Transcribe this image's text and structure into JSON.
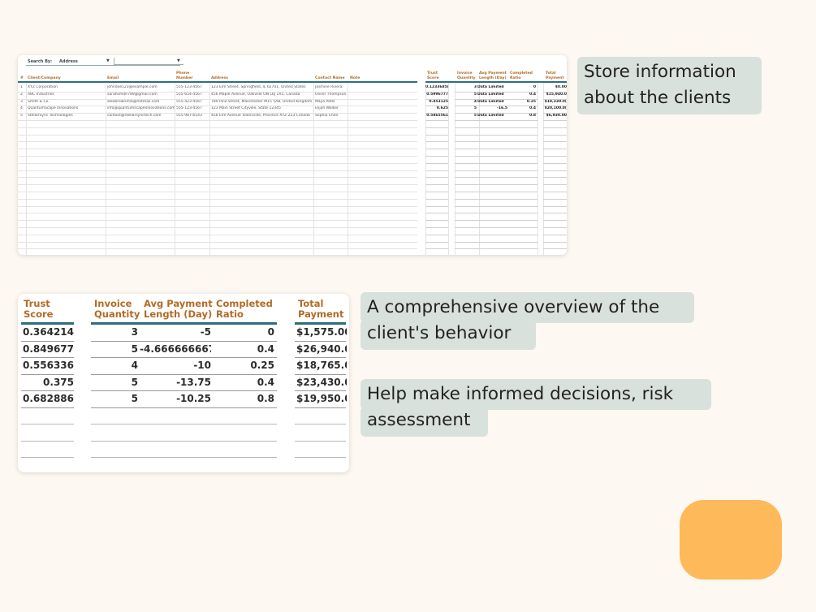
{
  "sheet": {
    "search_label": "Search By:",
    "search_value": "Address",
    "headers": {
      "num": "#",
      "client": "Client/Company",
      "email": "Email",
      "phone": "Phone Number",
      "address": "Address",
      "contact": "Contact Name",
      "note": "Note",
      "trust": "Trust Score",
      "invoice": "Invoice Quantity",
      "avg": "Avg Payment Length (Day)",
      "ratio": "Completed Ratio",
      "total": "Total Payment"
    },
    "rows": [
      {
        "num": "1",
        "client": "XYZ Corporation",
        "email": "johndoe123@example.com",
        "phone": "555-123-4567",
        "address": "123 Elm Street, Springfield, IL 62701, United States",
        "contact": "Jasmine Rivera",
        "trust": "0.1233685(",
        "invoice": "3",
        "avg": "Data Limited",
        "ratio": "0",
        "total": "$0.00"
      },
      {
        "num": "2",
        "client": "ABC Industries",
        "email": "sarahsmith789@gmail.com",
        "phone": "555-654-4567",
        "address": "456 Maple Avenue, Oakville ON L6J 1X5, Canada",
        "contact": "Oliver Thompson",
        "trust": "0.5996777",
        "invoice": "5",
        "avg": "Data Limited",
        "ratio": "0.4",
        "total": "$15,940.0"
      },
      {
        "num": "3",
        "client": "Smith & Co.",
        "email": "alexbrown456@hotmail.com",
        "phone": "555-423-4567",
        "address": "789 Pine Street, Manchester M15 5AB, United Kingdom",
        "contact": "Maya Patel",
        "trust": "0.453125",
        "invoice": "4",
        "avg": "Data Limited",
        "ratio": "0.25",
        "total": "$18,330.0("
      },
      {
        "num": "4",
        "client": "QuantumScape Innovations",
        "email": "info@quantumscapeinnovations.com",
        "phone": "555-123-4567",
        "address": "123 Main Street Cityville, State 12345",
        "contact": "Elijah Walker",
        "trust": "0.625",
        "invoice": "5",
        "avg": "-16.5",
        "ratio": "0.4",
        "total": "$20,100.0("
      },
      {
        "num": "5",
        "client": "StellarSync Technologies",
        "email": "contact@stellarsynctech.com",
        "phone": "555-987-6543",
        "address": "456 Elm Avenue Townsville, Province XYZ 223 Canada",
        "contact": "Sophia Chen",
        "trust": "0.5865561",
        "invoice": "5",
        "avg": "Data Limited",
        "ratio": "0.8",
        "total": "$6,930.00"
      }
    ]
  },
  "zoom": {
    "headers": {
      "trust": [
        "Trust",
        "Score"
      ],
      "invoice": [
        "Invoice",
        "Quantity"
      ],
      "avg": [
        "Avg Payment",
        "Length (Day)"
      ],
      "ratio": [
        "Completed",
        "Ratio"
      ],
      "total": [
        "Total",
        "Payment"
      ]
    },
    "rows": [
      {
        "trust": "0.3642142'",
        "invoice": "3",
        "avg": "-5",
        "ratio": "0",
        "total": "$1,575.00"
      },
      {
        "trust": "0.8496777",
        "invoice": "5",
        "avg": "-4.666666667",
        "ratio": "0.4",
        "total": "$26,940.0"
      },
      {
        "trust": "0.5563360",
        "invoice": "4",
        "avg": "-10",
        "ratio": "0.25",
        "total": "$18,765.0("
      },
      {
        "trust": "0.375",
        "invoice": "5",
        "avg": "-13.75",
        "ratio": "0.4",
        "total": "$23,430.0"
      },
      {
        "trust": "0.6828864",
        "invoice": "5",
        "avg": "-10.25",
        "ratio": "0.8",
        "total": "$19,950.0("
      }
    ]
  },
  "callouts": {
    "store": [
      "Store information",
      "about the clients"
    ],
    "overview": [
      "A comprehensive overview of the",
      "client's behavior"
    ],
    "decisions": [
      "Help make informed decisions, risk",
      "assessment"
    ]
  },
  "colors": {
    "background": "#fdf8f1",
    "header_text": "#b26b24",
    "header_rule": "#2f6e7e",
    "callout_bg": "#d9e1dc",
    "accent_blob": "#fdb95a"
  }
}
